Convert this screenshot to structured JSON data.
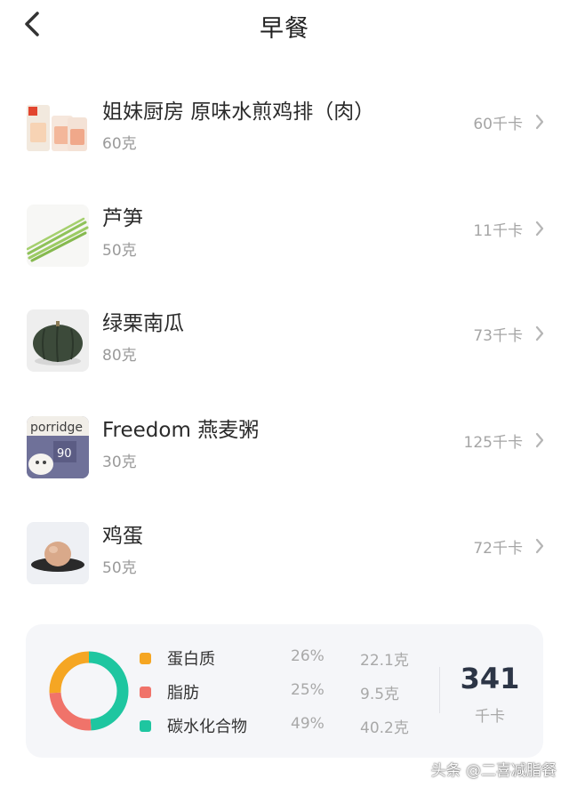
{
  "header": {
    "title": "早餐",
    "back_icon": "chevron-left-icon"
  },
  "foods": [
    {
      "name": "姐妹厨房 原味水煎鸡排（肉）",
      "weight": "60克",
      "kcal": "60千卡",
      "icon": "chicken-breast-package-thumbnail"
    },
    {
      "name": "芦笋",
      "weight": "50克",
      "kcal": "11千卡",
      "icon": "asparagus-thumbnail"
    },
    {
      "name": "绿栗南瓜",
      "weight": "80克",
      "kcal": "73千卡",
      "icon": "pumpkin-thumbnail"
    },
    {
      "name": "Freedom 燕麦粥",
      "weight": "30克",
      "kcal": "125千卡",
      "icon": "porridge-package-thumbnail",
      "package_text": {
        "brand": "porridge",
        "number": "90"
      }
    },
    {
      "name": "鸡蛋",
      "weight": "50克",
      "kcal": "72千卡",
      "icon": "egg-on-plate-thumbnail"
    }
  ],
  "summary": {
    "macros": [
      {
        "name": "蛋白质",
        "percent": "26%",
        "grams": "22.1克",
        "color": "#f5a623"
      },
      {
        "name": "脂肪",
        "percent": "25%",
        "grams": "9.5克",
        "color": "#f0736a"
      },
      {
        "name": "碳水化合物",
        "percent": "49%",
        "grams": "40.2克",
        "color": "#1ec6a0"
      }
    ],
    "total_kcal": "341",
    "total_unit": "千卡"
  },
  "watermark": "头条 @二喜减脂餐",
  "colors": {
    "card_bg": "#f5f6f9",
    "total_text": "#2c3546"
  }
}
